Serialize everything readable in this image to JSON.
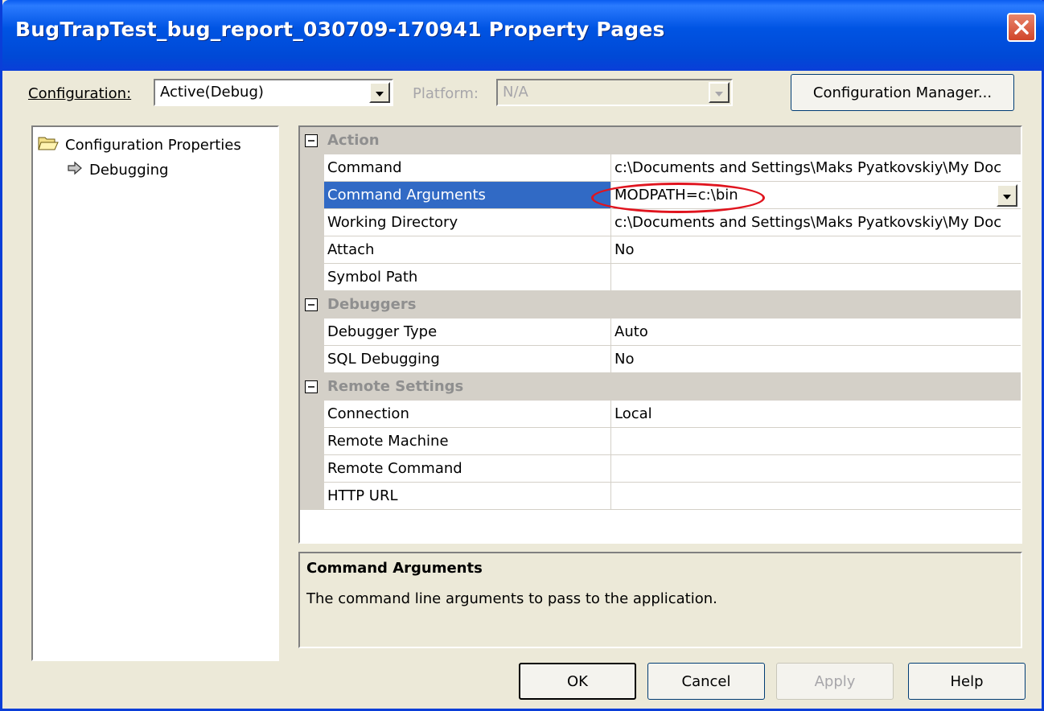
{
  "window": {
    "title": "BugTrapTest_bug_report_030709-170941 Property Pages",
    "close_icon": "close-icon",
    "accent": "#0054e3",
    "close_color": "#d0452a"
  },
  "toolbar": {
    "configuration_label": "Configuration:",
    "configuration_value": "Active(Debug)",
    "platform_label": "Platform:",
    "platform_value": "N/A",
    "config_manager_label": "Configuration Manager..."
  },
  "tree": {
    "root_label": "Configuration Properties",
    "root_icon": "folder-open-icon",
    "child_label": "Debugging",
    "child_icon": "arrow-right-icon"
  },
  "grid": {
    "categories": [
      {
        "label": "Action",
        "rows": [
          {
            "name": "Command",
            "value": "c:\\Documents and Settings\\Maks Pyatkovskiy\\My Doc"
          },
          {
            "name": "Command Arguments",
            "value": "MODPATH=c:\\bin",
            "selected": true
          },
          {
            "name": "Working Directory",
            "value": "c:\\Documents and Settings\\Maks Pyatkovskiy\\My Doc"
          },
          {
            "name": "Attach",
            "value": "No"
          },
          {
            "name": "Symbol Path",
            "value": ""
          }
        ]
      },
      {
        "label": "Debuggers",
        "rows": [
          {
            "name": "Debugger Type",
            "value": "Auto"
          },
          {
            "name": "SQL Debugging",
            "value": "No"
          }
        ]
      },
      {
        "label": "Remote Settings",
        "rows": [
          {
            "name": "Connection",
            "value": "Local"
          },
          {
            "name": "Remote Machine",
            "value": ""
          },
          {
            "name": "Remote Command",
            "value": ""
          },
          {
            "name": "HTTP URL",
            "value": ""
          }
        ]
      }
    ],
    "selection_color": "#316ac5",
    "highlight_color": "#e0141e"
  },
  "description": {
    "title": "Command Arguments",
    "text": "The command line arguments to pass to the application."
  },
  "buttons": {
    "ok": "OK",
    "cancel": "Cancel",
    "apply": "Apply",
    "help": "Help"
  }
}
